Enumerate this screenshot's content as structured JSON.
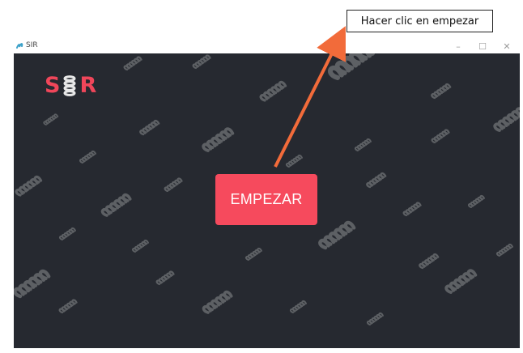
{
  "annotation": {
    "callout_text": "Hacer clic en empezar",
    "arrow_color": "#f26b3a"
  },
  "window": {
    "title": "SIR",
    "controls": {
      "minimize": "–",
      "maximize": "☐",
      "close": "✕"
    }
  },
  "app": {
    "logo_letters": [
      "S",
      "R"
    ],
    "logo_icon": "spring-icon",
    "start_button_label": "EMPEZAR",
    "colors": {
      "background": "#262930",
      "accent": "#f64a5d",
      "pattern": "#5d6064"
    }
  }
}
